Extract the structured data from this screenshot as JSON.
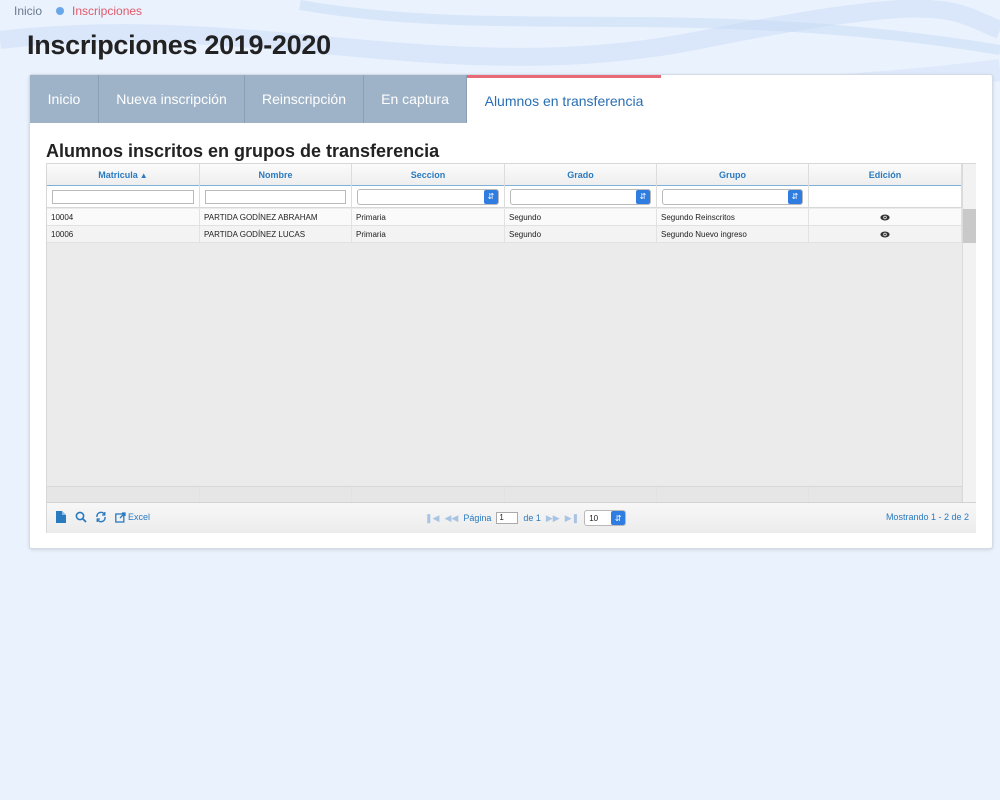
{
  "breadcrumb": {
    "home": "Inicio",
    "current": "Inscripciones"
  },
  "page_title": "Inscripciones 2019-2020",
  "tabs": [
    {
      "label": "Inicio",
      "active": false
    },
    {
      "label": "Nueva inscripción",
      "active": false
    },
    {
      "label": "Reinscripción",
      "active": false
    },
    {
      "label": "En captura",
      "active": false
    },
    {
      "label": "Alumnos en transferencia",
      "active": true
    }
  ],
  "section_title": "Alumnos inscritos en grupos de transferencia",
  "grid": {
    "columns": [
      "Matricula",
      "Nombre",
      "Seccion",
      "Grado",
      "Grupo",
      "Edición"
    ],
    "sort_column": "Matricula",
    "sort_direction": "asc",
    "filters": {
      "matricula": "",
      "nombre": "",
      "seccion": "",
      "grado": "",
      "grupo": ""
    },
    "rows": [
      {
        "matricula": "10004",
        "nombre": "PARTIDA GODÍNEZ ABRAHAM",
        "seccion": "Primaria",
        "grado": "Segundo",
        "grupo": "Segundo Reinscritos",
        "edicion_icon": "eye-icon"
      },
      {
        "matricula": "10006",
        "nombre": "PARTIDA GODÍNEZ LUCAS",
        "seccion": "Primaria",
        "grado": "Segundo",
        "grupo": "Segundo Nuevo ingreso",
        "edicion_icon": "eye-icon"
      }
    ]
  },
  "pager": {
    "excel_label": "Excel",
    "page_label": "Página",
    "page_value": "1",
    "of_label": "de 1",
    "rows_per_page": "10",
    "summary": "Mostrando 1 - 2 de 2"
  },
  "colors": {
    "accent_blue": "#2a7ac0",
    "tab_inactive": "#9eb3c8",
    "tab_active_border": "#e86a76",
    "breadcrumb_current": "#e05a6b",
    "select_button": "#2f7de1"
  }
}
